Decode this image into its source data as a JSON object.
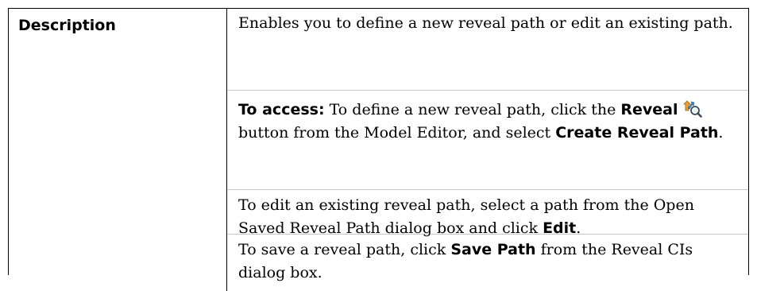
{
  "row": {
    "label": "Description",
    "para1": "Enables you to define a new reveal path or edit an existing path.",
    "access": {
      "label": "To access:",
      "text1": " To define a new reveal path, click the ",
      "reveal": "Reveal",
      "text2": " button from the Model Editor, and select ",
      "create": "Create Reveal Path",
      "end": "."
    },
    "edit": {
      "text": "To edit an existing reveal path, select a path from the Open Saved Reveal Path dialog box and click ",
      "bold": "Edit",
      "end": "."
    },
    "save": {
      "text1": "To save a reveal path, click ",
      "bold": "Save Path",
      "text2": " from the Reveal CIs dialog box."
    }
  },
  "icons": {
    "reveal": "reveal-icon"
  }
}
